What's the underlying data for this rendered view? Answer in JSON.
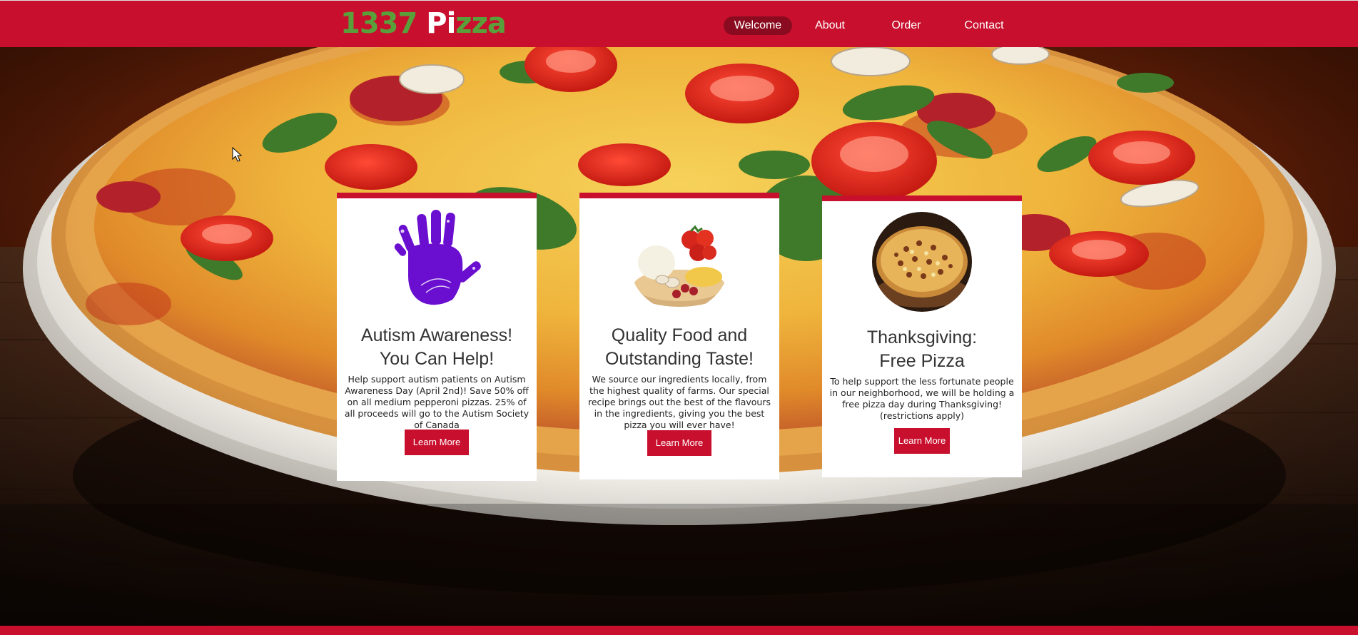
{
  "header": {
    "logo": {
      "part1": "1337",
      "space": " ",
      "part2": "Pi",
      "part3": "zza",
      "colors": {
        "green": "#5aa03a",
        "white": "#ffffff"
      }
    },
    "nav": [
      {
        "label": "Welcome",
        "active": true
      },
      {
        "label": "About",
        "active": false
      },
      {
        "label": "Order",
        "active": false
      },
      {
        "label": "Contact",
        "active": false
      }
    ]
  },
  "hero": {
    "cards": [
      {
        "image_icon": "purple-handprint-icon",
        "title_line1": "Autism Awareness!",
        "title_line2": "You Can Help!",
        "text": "Help support autism patients on Autism Awareness Day (April 2nd)! Save 50% off on all medium pepperoni pizzas. 25% of all proceeds will go to the Autism Society of Canada",
        "button": "Learn More"
      },
      {
        "image_icon": "fresh-ingredients-image",
        "title_line1": "Quality Food and",
        "title_line2": "Outstanding Taste!",
        "text": "We source our ingredients locally, from the highest quality of farms. Our special recipe brings out the best of the flavours in the ingredients, giving you the best pizza you will ever have!",
        "button": "Learn More"
      },
      {
        "image_icon": "pizza-image",
        "title_line1": "Thanksgiving:",
        "title_line2": "Free Pizza",
        "text": "To help support the less fortunate people in our neighborhood, we will be holding a free pizza day during Thanksgiving! (restrictions apply)",
        "button": "Learn More"
      }
    ]
  },
  "colors": {
    "brand_red": "#c8102e",
    "active_nav": "#8a0b1f",
    "hand_purple": "#6a0ed0"
  }
}
